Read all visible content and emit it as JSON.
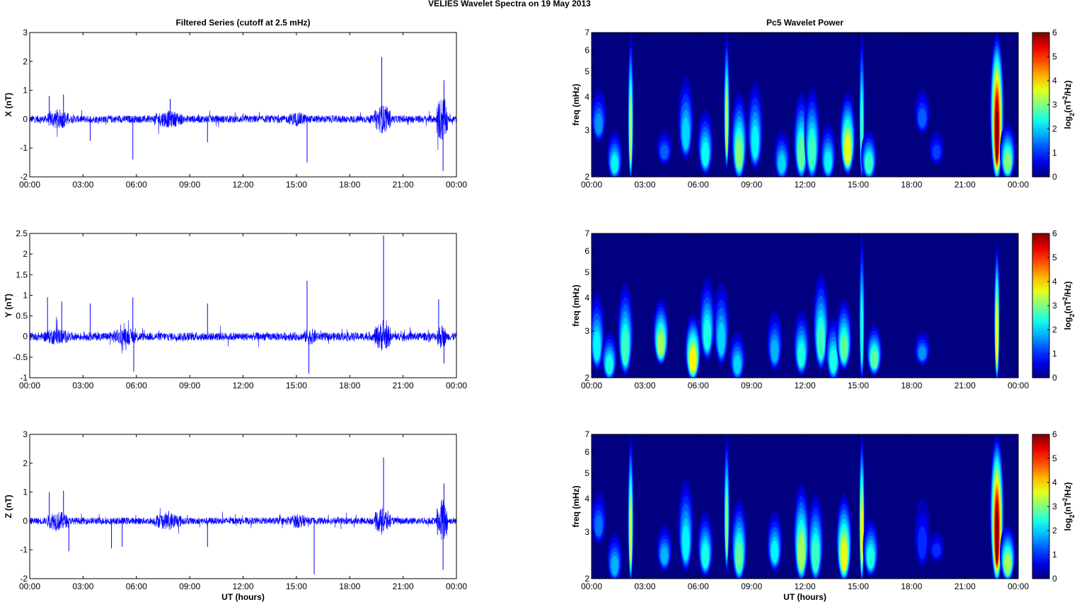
{
  "title": "VELIES Wavelet Spectra on 19 May      2013",
  "chart_data": [
    {
      "type": "line",
      "title": "Filtered Series (cutoff at 2.5 mHz)",
      "ylabel": "X (nT)",
      "xlabel": "",
      "xlim": [
        0,
        24
      ],
      "xticks": [
        "00:00",
        "03:00",
        "06:00",
        "09:00",
        "12:00",
        "15:00",
        "18:00",
        "21:00",
        "00:00"
      ],
      "ylim": [
        -2,
        3
      ],
      "yticks": [
        "-2",
        "-1",
        "0",
        "1",
        "2",
        "3"
      ],
      "noise_base": 0.13,
      "bursts": [
        [
          1.0,
          2.2,
          0.35
        ],
        [
          7.0,
          8.6,
          0.3
        ],
        [
          14.5,
          15.6,
          0.25
        ],
        [
          19.4,
          20.3,
          0.5
        ],
        [
          22.9,
          23.5,
          0.8
        ]
      ],
      "spikes": [
        [
          1.1,
          0.8
        ],
        [
          1.9,
          0.85
        ],
        [
          3.4,
          -0.75
        ],
        [
          5.8,
          -1.4
        ],
        [
          7.9,
          0.7
        ],
        [
          10.0,
          -0.8
        ],
        [
          15.6,
          -1.5
        ],
        [
          19.8,
          2.15
        ],
        [
          23.25,
          -1.8
        ],
        [
          23.3,
          1.35
        ]
      ],
      "color": "#0000ff"
    },
    {
      "type": "line",
      "title": "",
      "ylabel": "Y (nT)",
      "xlabel": "",
      "xlim": [
        0,
        24
      ],
      "xticks": [
        "00:00",
        "03:00",
        "06:00",
        "09:00",
        "12:00",
        "15:00",
        "18:00",
        "21:00",
        "00:00"
      ],
      "ylim": [
        -1,
        2.5
      ],
      "yticks": [
        "-1",
        "-0.5",
        "0",
        "0.5",
        "1",
        "1.5",
        "2",
        "2.5"
      ],
      "noise_base": 0.1,
      "bursts": [
        [
          0.8,
          2.2,
          0.2
        ],
        [
          4.5,
          6.2,
          0.2
        ],
        [
          15.4,
          16.2,
          0.2
        ],
        [
          19.4,
          20.3,
          0.35
        ],
        [
          22.9,
          23.4,
          0.3
        ]
      ],
      "spikes": [
        [
          1.0,
          0.95
        ],
        [
          1.8,
          0.85
        ],
        [
          3.4,
          0.8
        ],
        [
          5.8,
          0.95
        ],
        [
          5.85,
          -0.85
        ],
        [
          10.0,
          0.8
        ],
        [
          15.6,
          1.35
        ],
        [
          15.7,
          -0.9
        ],
        [
          19.9,
          2.45
        ],
        [
          23.0,
          0.9
        ],
        [
          23.3,
          -0.65
        ]
      ],
      "color": "#0000ff"
    },
    {
      "type": "line",
      "title": "",
      "ylabel": "Z (nT)",
      "xlabel": "UT (hours)",
      "xlim": [
        0,
        24
      ],
      "xticks": [
        "00:00",
        "03:00",
        "06:00",
        "09:00",
        "12:00",
        "15:00",
        "18:00",
        "21:00",
        "00:00"
      ],
      "ylim": [
        -2,
        3
      ],
      "yticks": [
        "-2",
        "-1",
        "0",
        "1",
        "2",
        "3"
      ],
      "noise_base": 0.12,
      "bursts": [
        [
          1.0,
          2.1,
          0.35
        ],
        [
          7.0,
          8.6,
          0.3
        ],
        [
          14.5,
          15.6,
          0.25
        ],
        [
          19.4,
          20.3,
          0.45
        ],
        [
          22.9,
          23.5,
          0.8
        ]
      ],
      "spikes": [
        [
          1.1,
          1.0
        ],
        [
          1.9,
          1.05
        ],
        [
          2.2,
          -1.05
        ],
        [
          4.6,
          -0.95
        ],
        [
          5.2,
          -0.9
        ],
        [
          10.0,
          -0.9
        ],
        [
          16.0,
          -1.85
        ],
        [
          19.9,
          2.2
        ],
        [
          23.25,
          -1.7
        ],
        [
          23.3,
          1.3
        ]
      ],
      "color": "#0000ff"
    },
    {
      "type": "heatmap",
      "title": "Pc5 Wavelet Power",
      "ylabel": "freq (mHz)",
      "xlabel": "",
      "xlim": [
        0,
        24
      ],
      "xticks": [
        "00:00",
        "03:00",
        "06:00",
        "09:00",
        "12:00",
        "15:00",
        "18:00",
        "21:00",
        "00:00"
      ],
      "ylim": [
        2,
        7
      ],
      "yticks": [
        "2",
        "3",
        "4",
        "5",
        "6",
        "7"
      ],
      "colorbar": {
        "label": "log2(nT^2/Hz)",
        "range": [
          0,
          6
        ],
        "ticks": [
          "0",
          "1",
          "2",
          "3",
          "4",
          "5",
          "6"
        ]
      },
      "blobs": [
        [
          0.4,
          2.8,
          4.3,
          1.6
        ],
        [
          1.3,
          2.0,
          3.0,
          2.2
        ],
        [
          2.2,
          2.0,
          7,
          3.2
        ],
        [
          4.1,
          2.3,
          3.0,
          1.3
        ],
        [
          5.3,
          2.4,
          4.8,
          2.0
        ],
        [
          6.4,
          2.1,
          3.6,
          2.3
        ],
        [
          7.6,
          2.2,
          7,
          3.3
        ],
        [
          8.3,
          2.0,
          4.2,
          3.0
        ],
        [
          9.2,
          2.2,
          4.6,
          2.2
        ],
        [
          10.7,
          2.0,
          3.0,
          2.0
        ],
        [
          11.8,
          2.0,
          4.2,
          2.8
        ],
        [
          12.4,
          2.0,
          4.4,
          2.6
        ],
        [
          13.3,
          2.0,
          3.2,
          2.2
        ],
        [
          14.4,
          2.1,
          4.2,
          3.6
        ],
        [
          15.2,
          2.0,
          7,
          2.6
        ],
        [
          15.6,
          2.0,
          3.0,
          2.6
        ],
        [
          18.6,
          3.0,
          4.3,
          1.3
        ],
        [
          19.4,
          2.3,
          3.0,
          1.1
        ],
        [
          22.8,
          2.0,
          7,
          6.0
        ],
        [
          23.4,
          2.0,
          3.2,
          3.0
        ]
      ]
    },
    {
      "type": "heatmap",
      "title": "",
      "ylabel": "freq (mHz)",
      "xlabel": "",
      "xlim": [
        0,
        24
      ],
      "xticks": [
        "00:00",
        "03:00",
        "06:00",
        "09:00",
        "12:00",
        "15:00",
        "18:00",
        "21:00",
        "00:00"
      ],
      "ylim": [
        2,
        7
      ],
      "yticks": [
        "2",
        "3",
        "4",
        "5",
        "6",
        "7"
      ],
      "colorbar": {
        "label": "log2(nT^2/Hz)",
        "range": [
          0,
          6
        ],
        "ticks": [
          "0",
          "1",
          "2",
          "3",
          "4",
          "5",
          "6"
        ]
      },
      "blobs": [
        [
          0.3,
          2.2,
          4.2,
          2.2
        ],
        [
          1.0,
          2.0,
          3.0,
          2.4
        ],
        [
          1.9,
          2.1,
          4.6,
          2.6
        ],
        [
          3.9,
          2.3,
          4.0,
          3.2
        ],
        [
          5.7,
          2.0,
          3.5,
          3.8
        ],
        [
          6.5,
          2.4,
          4.8,
          2.4
        ],
        [
          7.3,
          2.3,
          4.6,
          2.0
        ],
        [
          8.2,
          2.0,
          3.0,
          2.0
        ],
        [
          10.3,
          2.2,
          3.6,
          1.8
        ],
        [
          11.8,
          2.1,
          3.6,
          2.4
        ],
        [
          12.9,
          2.2,
          5.0,
          2.6
        ],
        [
          13.6,
          2.0,
          3.4,
          2.4
        ],
        [
          14.2,
          2.2,
          4.0,
          2.8
        ],
        [
          15.2,
          2.0,
          7,
          2.4
        ],
        [
          15.9,
          2.1,
          3.2,
          2.8
        ],
        [
          18.6,
          2.3,
          3.0,
          1.6
        ],
        [
          22.8,
          2.0,
          6.5,
          3.8
        ]
      ]
    },
    {
      "type": "heatmap",
      "title": "",
      "ylabel": "freq (mHz)",
      "xlabel": "UT (hours)",
      "xlim": [
        0,
        24
      ],
      "xticks": [
        "00:00",
        "03:00",
        "06:00",
        "09:00",
        "12:00",
        "15:00",
        "18:00",
        "21:00",
        "00:00"
      ],
      "ylim": [
        2,
        7
      ],
      "yticks": [
        "2",
        "3",
        "4",
        "5",
        "6",
        "7"
      ],
      "colorbar": {
        "label": "log2(nT^2/Hz)",
        "range": [
          0,
          6
        ],
        "ticks": [
          "0",
          "1",
          "2",
          "3",
          "4",
          "5",
          "6"
        ]
      },
      "blobs": [
        [
          0.4,
          2.8,
          4.3,
          1.4
        ],
        [
          1.3,
          2.0,
          3.0,
          1.8
        ],
        [
          2.2,
          2.0,
          7,
          3.4
        ],
        [
          4.1,
          2.2,
          3.2,
          1.8
        ],
        [
          5.3,
          2.2,
          4.8,
          2.2
        ],
        [
          6.4,
          2.1,
          3.6,
          2.4
        ],
        [
          7.6,
          2.2,
          7,
          3.0
        ],
        [
          8.3,
          2.0,
          4.0,
          2.8
        ],
        [
          10.3,
          2.2,
          3.6,
          2.2
        ],
        [
          11.8,
          2.0,
          4.6,
          3.2
        ],
        [
          12.6,
          2.0,
          4.2,
          2.6
        ],
        [
          14.2,
          2.0,
          4.2,
          3.6
        ],
        [
          15.2,
          2.0,
          7,
          3.8
        ],
        [
          15.7,
          2.1,
          3.4,
          2.4
        ],
        [
          18.6,
          2.3,
          4.0,
          1.0
        ],
        [
          19.4,
          2.4,
          3.0,
          1.0
        ],
        [
          22.8,
          2.0,
          7,
          6.0
        ],
        [
          23.4,
          2.0,
          3.2,
          3.2
        ]
      ]
    }
  ]
}
